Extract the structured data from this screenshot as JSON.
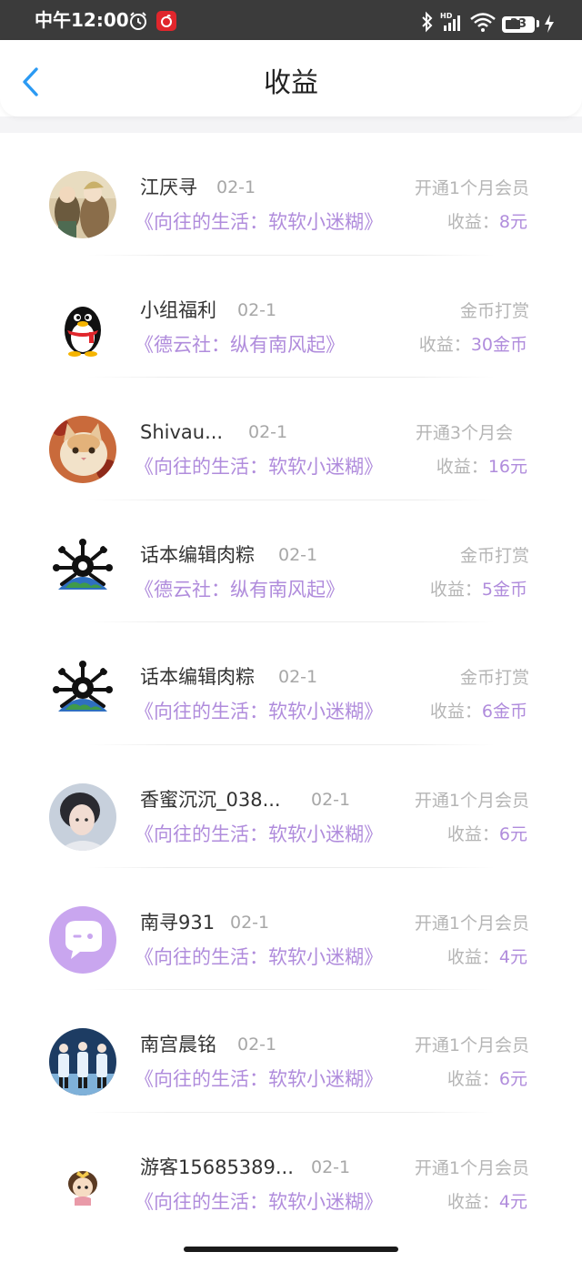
{
  "status_bar": {
    "time": "中午12:00",
    "battery_level": "23",
    "icons": [
      "alarm-icon",
      "netease-music-icon",
      "bluetooth-icon",
      "hd-signal-icon",
      "wifi-icon",
      "battery-icon",
      "charging-icon"
    ]
  },
  "header": {
    "title": "收益",
    "back_icon": "chevron-left-icon"
  },
  "colors": {
    "accent_purple": "#b08cdc",
    "back_blue": "#2b9af3",
    "muted_gray": "#b5b5b5"
  },
  "items": [
    {
      "name": "江厌寻",
      "date": "02-1",
      "work": "《向往的生活：软软小迷糊》",
      "type": "开通1个月会员",
      "earning_label": "收益：",
      "earning_value": "8元",
      "avatar": "anime-illustration-avatar"
    },
    {
      "name": "小组福利",
      "date": "02-1",
      "work": "《德云社：纵有南风起》",
      "type": "金币打赏",
      "earning_label": "收益：",
      "earning_value": "30金币",
      "avatar": "qq-penguin-avatar"
    },
    {
      "name": "Shivau...",
      "date": "02-1",
      "work": "《向往的生活：软软小迷糊》",
      "type": "开通3个月会",
      "earning_label": "收益：",
      "earning_value": "16元",
      "avatar": "cat-avatar"
    },
    {
      "name": "话本编辑肉粽",
      "date": "02-1",
      "work": "《德云社：纵有南风起》",
      "type": "金币打赏",
      "earning_label": "收益：",
      "earning_value": "5金币",
      "avatar": "earth-virus-avatar"
    },
    {
      "name": "话本编辑肉粽",
      "date": "02-1",
      "work": "《向往的生活：软软小迷糊》",
      "type": "金币打赏",
      "earning_label": "收益：",
      "earning_value": "6金币",
      "avatar": "earth-virus-avatar"
    },
    {
      "name": "香蜜沉沉_038...",
      "date": "02-1",
      "work": "《向往的生活：软软小迷糊》",
      "type": "开通1个月会员",
      "earning_label": "收益：",
      "earning_value": "6元",
      "avatar": "portrait-photo-avatar"
    },
    {
      "name": "南寻931",
      "date": "02-1",
      "work": "《向往的生活：软软小迷糊》",
      "type": "开通1个月会员",
      "earning_label": "收益：",
      "earning_value": "4元",
      "avatar": "default-chat-bubble-avatar"
    },
    {
      "name": "南宫晨铭",
      "date": "02-1",
      "work": "《向往的生活：软软小迷糊》",
      "type": "开通1个月会员",
      "earning_label": "收益：",
      "earning_value": "6元",
      "avatar": "group-photo-avatar"
    },
    {
      "name": "游客15685389...",
      "date": "02-1",
      "work": "《向往的生活：软软小迷糊》",
      "type": "开通1个月会员",
      "earning_label": "收益：",
      "earning_value": "4元",
      "avatar": "cartoon-girl-avatar"
    }
  ]
}
